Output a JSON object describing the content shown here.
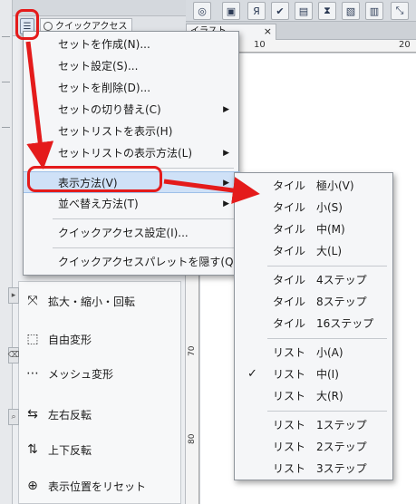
{
  "colors": {
    "annotation_red": "#e41b1b",
    "highlight_pink": "#eb7d87",
    "menu_highlight": "#cfe1f7"
  },
  "quick_access": {
    "tab_label": "クイックアクセス",
    "menu_icon": "panel-menu-icon",
    "items": [
      {
        "label": "拡大・縮小・回転",
        "icon": "transform-icon"
      },
      {
        "label": "自由変形",
        "icon": "free-transform-icon"
      },
      {
        "label": "メッシュ変形",
        "icon": "mesh-transform-icon"
      },
      {
        "label": "左右反転",
        "icon": "flip-horizontal-icon"
      },
      {
        "label": "上下反転",
        "icon": "flip-vertical-icon"
      },
      {
        "label": "表示位置をリセット",
        "icon": "reset-view-icon"
      }
    ]
  },
  "canvas": {
    "tab_label": "イラスト",
    "close_label": "×",
    "ruler_top": [
      "10",
      "20"
    ],
    "ruler_left": [
      "70",
      "80"
    ]
  },
  "menu_main": {
    "items": [
      {
        "label": "セットを作成(N)...",
        "submenu": false
      },
      {
        "label": "セット設定(S)...",
        "submenu": false
      },
      {
        "label": "セットを削除(D)...",
        "submenu": false
      },
      {
        "label": "セットの切り替え(C)",
        "submenu": true
      },
      {
        "label": "セットリストを表示(H)",
        "submenu": false
      },
      {
        "label": "セットリストの表示方法(L)",
        "submenu": true
      },
      {
        "label": "表示方法(V)",
        "submenu": true,
        "highlighted": true
      },
      {
        "label": "並べ替え方法(T)",
        "submenu": true
      },
      {
        "label": "クイックアクセス設定(I)...",
        "submenu": false
      },
      {
        "label": "クイックアクセスパレットを隠す(Q)",
        "submenu": false
      }
    ]
  },
  "menu_sub": {
    "groups": [
      [
        "タイル　極小(V)",
        "タイル　小(S)",
        "タイル　中(M)",
        "タイル　大(L)"
      ],
      [
        "タイル　4ステップ",
        "タイル　8ステップ",
        "タイル　16ステップ"
      ],
      [
        "リスト　小(A)",
        "リスト　中(I)",
        "リスト　大(R)"
      ],
      [
        "リスト　1ステップ",
        "リスト　2ステップ",
        "リスト　3ステップ"
      ]
    ],
    "checked_item": "リスト　中(I)",
    "check_mark": "✓",
    "emphasized_item": "タイル　極小(V)"
  }
}
